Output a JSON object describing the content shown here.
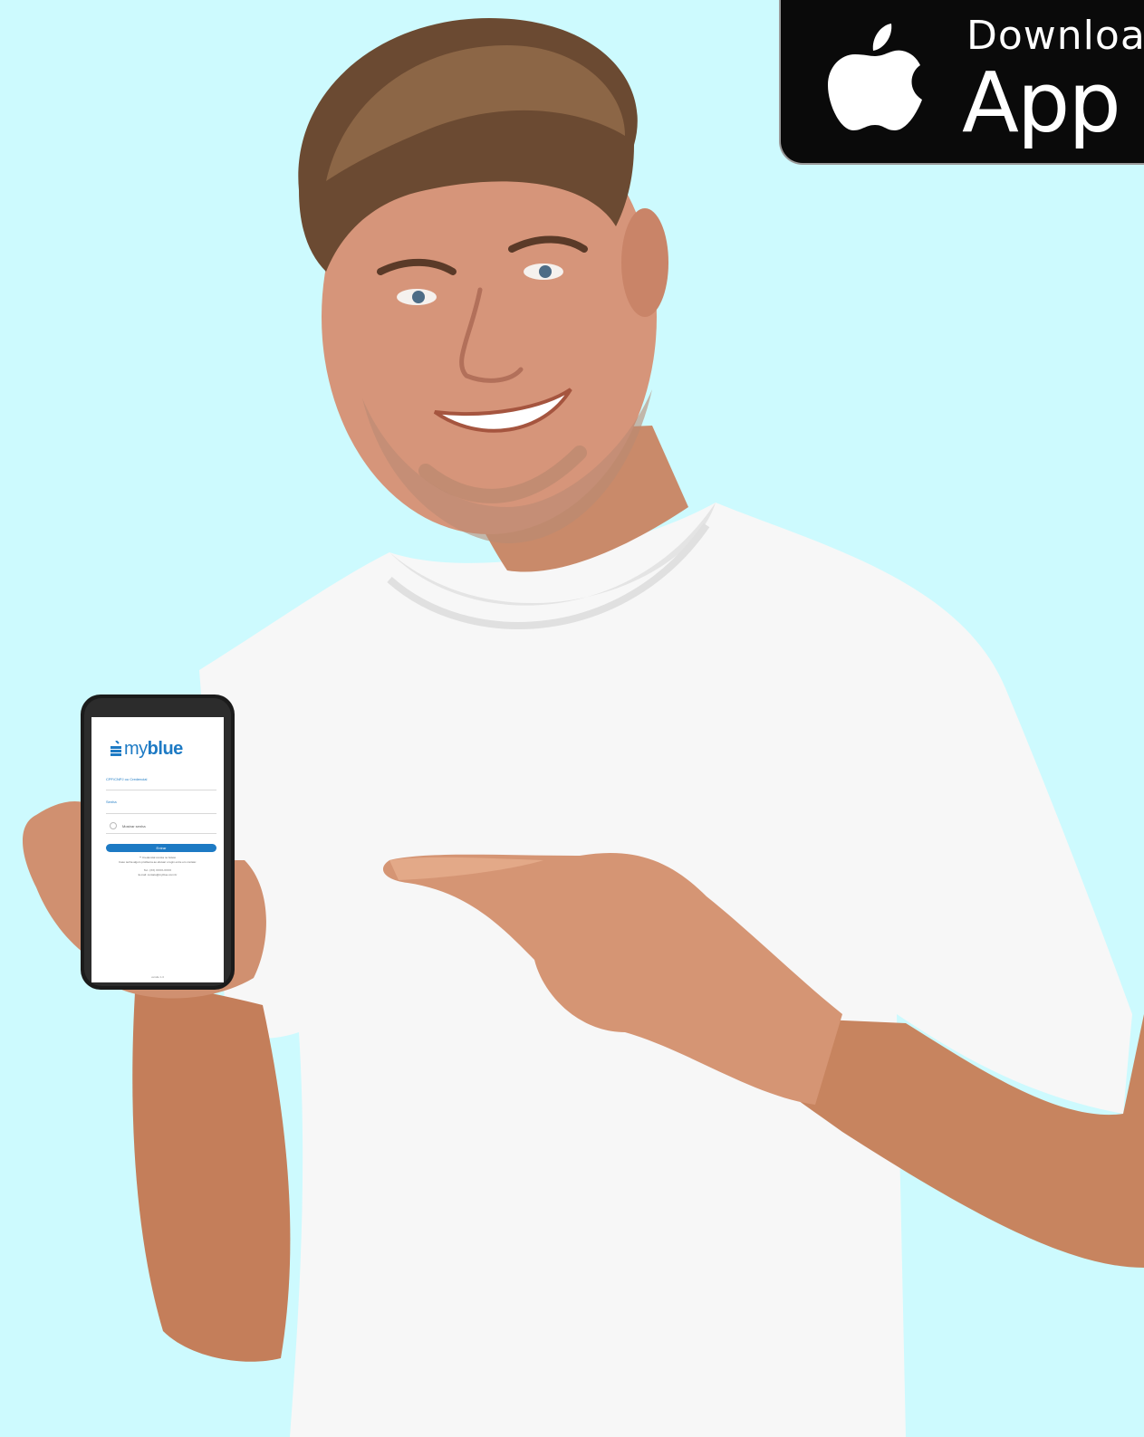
{
  "badge": {
    "line1": "Download on the",
    "line2": "App Store",
    "icon": "apple-icon"
  },
  "phone_screen": {
    "logo_text_light": "my",
    "logo_text_bold": "blue",
    "logo_icon": "myblue-logo-icon",
    "login_label": "CPF/CNPJ ou Credencial",
    "password_label": "Senha",
    "show_password_label": "Mostrar senha",
    "enter_button": "Entrar",
    "info_line1": "** Credencial consta no boleto",
    "info_line2": "Caso tenha algum problema ao efetuar o login entre em contato:",
    "info_line3": "Tel.: (XX) XXXX-XXXX",
    "info_line4": "E-mail: contato@myblue.com.br",
    "version": "versão 1.0"
  },
  "colors": {
    "background": "#cdfafe",
    "brand_blue": "#1d7ac4",
    "badge_black": "#0a0a0a"
  }
}
